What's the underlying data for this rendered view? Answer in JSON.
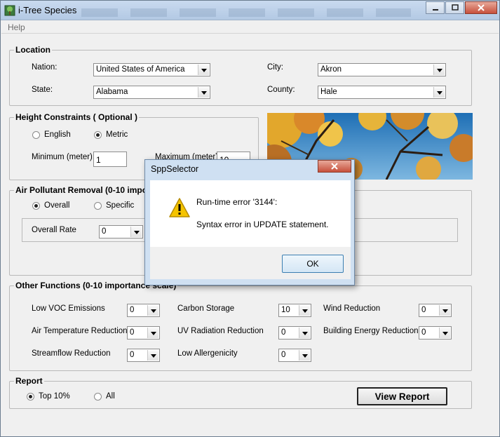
{
  "window": {
    "title": "i-Tree Species"
  },
  "menu": {
    "help": "Help"
  },
  "location": {
    "legend": "Location",
    "nation_label": "Nation:",
    "nation_value": "United States of America",
    "state_label": "State:",
    "state_value": "Alabama",
    "city_label": "City:",
    "city_value": "Akron",
    "county_label": "County:",
    "county_value": "Hale"
  },
  "height": {
    "legend": "Height Constraints ( Optional )",
    "english": "English",
    "metric": "Metric",
    "selected": "metric",
    "min_label": "Minimum (meter):",
    "min_value": "1",
    "max_label": "Maximum (meter):",
    "max_value": "10"
  },
  "air": {
    "legend": "Air Pollutant Removal (0-10 impo",
    "overall": "Overall",
    "specific": "Specific",
    "selected": "overall",
    "overall_rate_label": "Overall Rate",
    "overall_rate_value": "0"
  },
  "other": {
    "legend": "Other Functions (0-10 importance scale)",
    "items": [
      {
        "label": "Low VOC Emissions",
        "value": "0"
      },
      {
        "label": "Air Temperature Reduction",
        "value": "0"
      },
      {
        "label": "Streamflow Reduction",
        "value": "0"
      },
      {
        "label": "Carbon Storage",
        "value": "10"
      },
      {
        "label": "UV Radiation Reduction",
        "value": "0"
      },
      {
        "label": "Low Allergenicity",
        "value": "0"
      },
      {
        "label": "Wind Reduction",
        "value": "0"
      },
      {
        "label": "Building Energy Reduction",
        "value": "0"
      }
    ]
  },
  "report": {
    "legend": "Report",
    "top": "Top 10%",
    "all": "All",
    "selected": "top",
    "view_button": "View Report"
  },
  "dialog": {
    "title": "SppSelector",
    "line1": "Run-time error '3144':",
    "line2": "Syntax error in UPDATE statement.",
    "ok": "OK"
  },
  "icons": {
    "app": "tree-icon",
    "warning": "warning-icon",
    "minimize": "minimize-icon",
    "maximize": "maximize-icon",
    "close": "close-icon"
  }
}
